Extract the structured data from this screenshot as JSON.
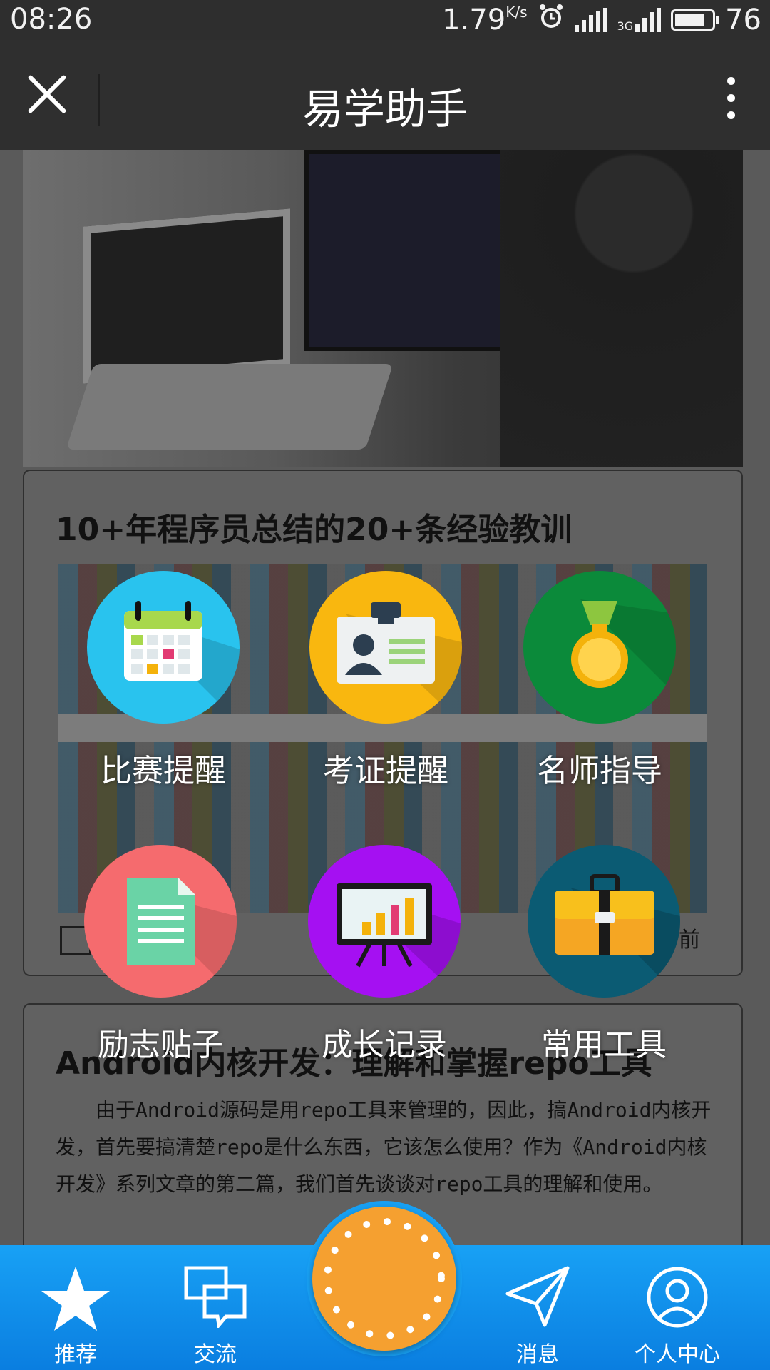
{
  "status_bar": {
    "time": "08:26",
    "speed": "1.79",
    "speed_unit": "K/s",
    "network": "3G",
    "battery": "76"
  },
  "app_bar": {
    "title": "易学助手"
  },
  "articles": [
    {
      "title": "10+年程序员总结的20+条经验教训",
      "time_suffix": "前"
    },
    {
      "title": "Android内核开发：理解和掌握repo工具",
      "excerpt": "由于Android源码是用repo工具来管理的，因此，搞Android内核开发，首先要搞清楚repo是什么东西，它该怎么使用？作为《Android内核开发》系列文章的第二篇，我们首先谈谈对repo工具的理解和使用。"
    }
  ],
  "menu": [
    {
      "label": "比赛提醒",
      "icon": "calendar-icon",
      "color": "#29c3ee"
    },
    {
      "label": "考证提醒",
      "icon": "id-card-icon",
      "color": "#f9b70f"
    },
    {
      "label": "名师指导",
      "icon": "medal-icon",
      "color": "#0b8a3a"
    },
    {
      "label": "励志贴子",
      "icon": "document-icon",
      "color": "#f56b6e"
    },
    {
      "label": "成长记录",
      "icon": "chart-board-icon",
      "color": "#a510f2"
    },
    {
      "label": "常用工具",
      "icon": "toolbox-icon",
      "color": "#0b5b73"
    }
  ],
  "tabs": [
    {
      "label": "推荐",
      "icon": "star-icon"
    },
    {
      "label": "交流",
      "icon": "chat-bubbles-icon"
    },
    {
      "label": "消息",
      "icon": "paper-plane-icon"
    },
    {
      "label": "个人中心",
      "icon": "user-icon"
    }
  ]
}
